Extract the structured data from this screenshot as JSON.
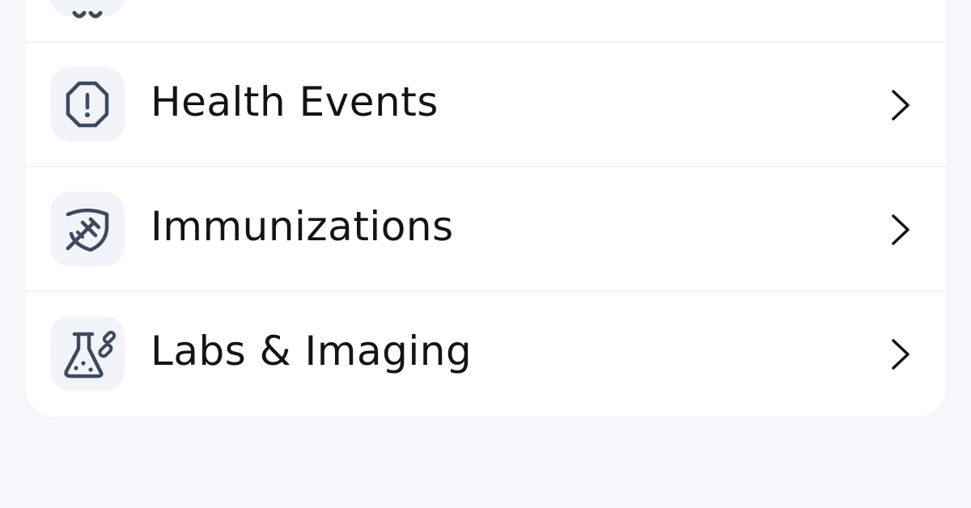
{
  "list": {
    "items": [
      {
        "label": "Health Events",
        "icon": "alert-octagon-icon"
      },
      {
        "label": "Immunizations",
        "icon": "shield-syringe-icon"
      },
      {
        "label": "Labs & Imaging",
        "icon": "flask-pill-icon"
      }
    ],
    "partial_top_item_icon": "glasses-icon"
  },
  "colors": {
    "page_background": "#f6f7fb",
    "card_background": "#ffffff",
    "icon_tile_background": "#f2f4f9",
    "icon_stroke": "#3d4a5e",
    "text": "#121418"
  }
}
